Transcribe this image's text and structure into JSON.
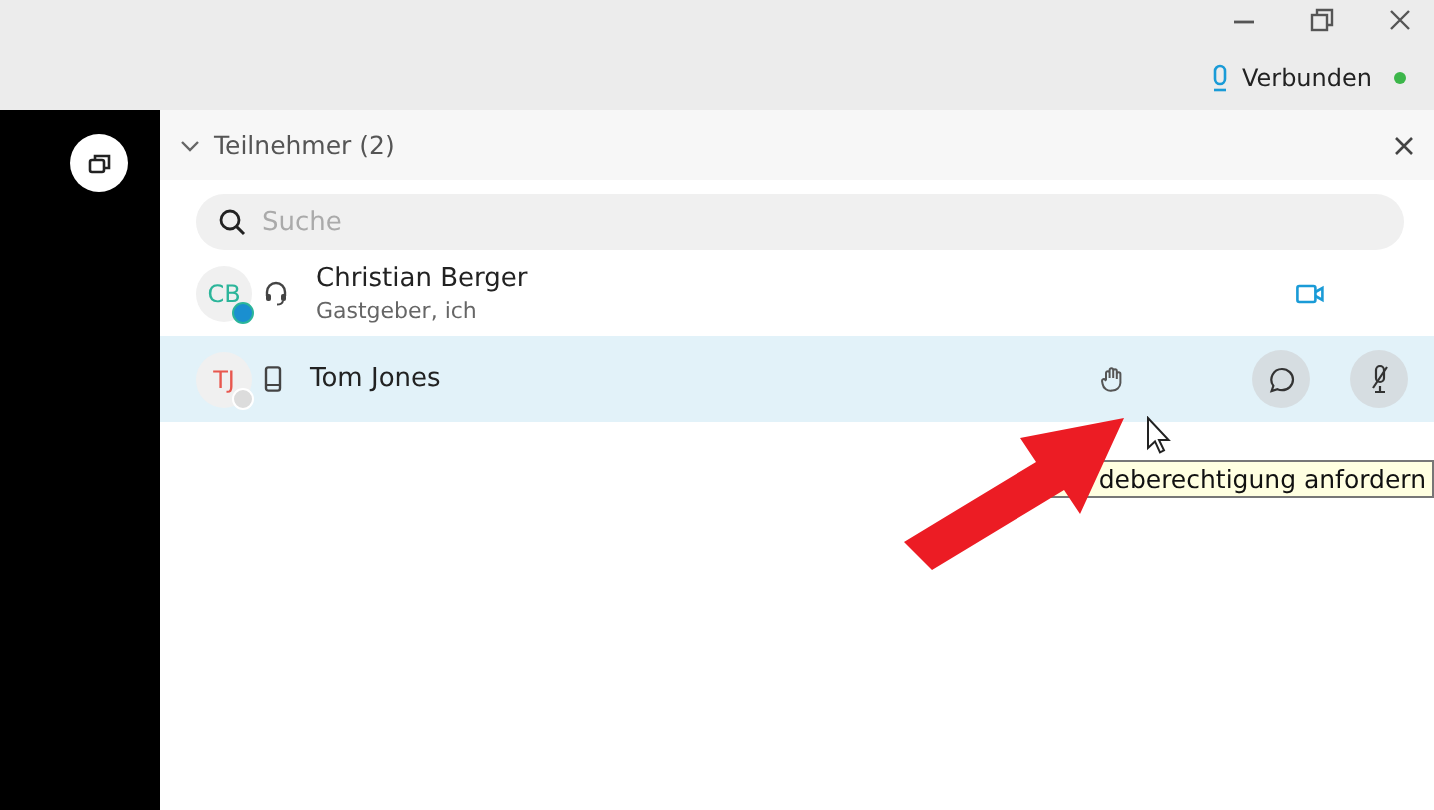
{
  "status": {
    "label": "Verbunden",
    "connected": true
  },
  "panel": {
    "title": "Teilnehmer (2)",
    "expanded": true
  },
  "search": {
    "placeholder": "Suche"
  },
  "participants": [
    {
      "initials": "CB",
      "name": "Christian Berger",
      "role": "Gastgeber, ich",
      "kind": "headset",
      "color": "#2bb59a",
      "online": true,
      "selected": false,
      "video": true,
      "actions": false
    },
    {
      "initials": "TJ",
      "name": "Tom Jones",
      "kind": "phone",
      "color": "#e8574e",
      "online": false,
      "selected": true,
      "video": false,
      "actions": true
    }
  ],
  "tooltip": {
    "text": "deberechtigung anfordern"
  }
}
